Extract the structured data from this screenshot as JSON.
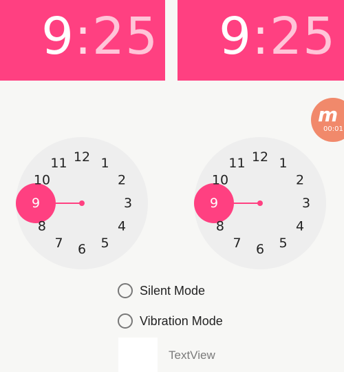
{
  "header": {
    "left": {
      "hour": "9",
      "sep": ":",
      "minute": "25"
    },
    "right": {
      "hour": "9",
      "sep": ":",
      "minute": "25"
    }
  },
  "recorder_badge": {
    "icon": "recorder-logo-icon",
    "glyph": "m",
    "timer": "00:01"
  },
  "clocks": {
    "numbers": [
      "12",
      "1",
      "2",
      "3",
      "4",
      "5",
      "6",
      "7",
      "8",
      "9",
      "10",
      "11"
    ],
    "selected_number": "9",
    "selected_color": "#ff4081",
    "face_color": "#eeeeee"
  },
  "options": {
    "silent_label": "Silent Mode",
    "vibration_label": "Vibration Mode"
  },
  "textview_label": "TextView",
  "colors": {
    "accent": "#ff4081",
    "background": "#f7f7f5"
  }
}
